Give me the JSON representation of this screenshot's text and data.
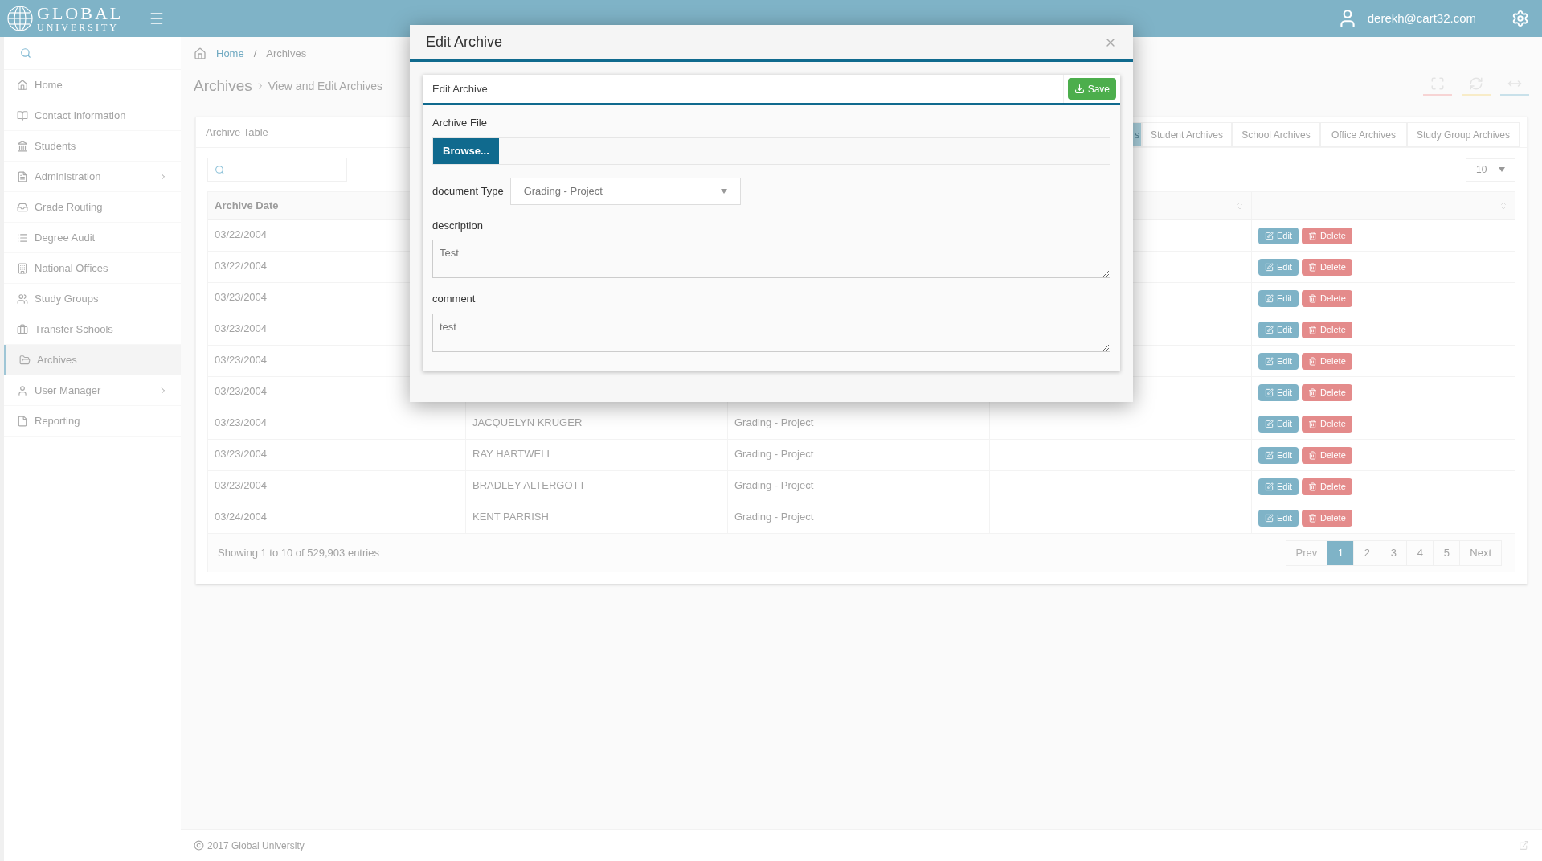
{
  "header": {
    "logo_top": "GLOBAL",
    "logo_bottom": "UNIVERSITY",
    "user": "derekh@cart32.com"
  },
  "sidebar": {
    "items": [
      {
        "label": "Home",
        "selected": false,
        "submenu": false
      },
      {
        "label": "Contact Information",
        "selected": false,
        "submenu": false
      },
      {
        "label": "Students",
        "selected": false,
        "submenu": false
      },
      {
        "label": "Administration",
        "selected": false,
        "submenu": true
      },
      {
        "label": "Grade Routing",
        "selected": false,
        "submenu": false
      },
      {
        "label": "Degree Audit",
        "selected": false,
        "submenu": false
      },
      {
        "label": "National Offices",
        "selected": false,
        "submenu": false
      },
      {
        "label": "Study Groups",
        "selected": false,
        "submenu": false
      },
      {
        "label": "Transfer Schools",
        "selected": false,
        "submenu": false
      },
      {
        "label": "Archives",
        "selected": true,
        "submenu": false
      },
      {
        "label": "User Manager",
        "selected": false,
        "submenu": true
      },
      {
        "label": "Reporting",
        "selected": false,
        "submenu": false
      }
    ]
  },
  "breadcrumb": {
    "items": [
      "Home",
      "Archives"
    ],
    "separator": "/"
  },
  "page_title": {
    "title": "Archives",
    "subtitle": "View and Edit Archives"
  },
  "panel": {
    "title": "Archive Table",
    "tabs": [
      {
        "label": "s",
        "selected": true
      },
      {
        "label": "Student Archives",
        "selected": false
      },
      {
        "label": "School Archives",
        "selected": false
      },
      {
        "label": "Office Archives",
        "selected": false
      },
      {
        "label": "Study Group Archives",
        "selected": false
      }
    ],
    "page_size": "10",
    "columns": [
      "Archive Date"
    ],
    "rows": [
      {
        "date": "03/22/2004",
        "actions": [
          "Edit",
          "Delete"
        ]
      },
      {
        "date": "03/22/2004",
        "actions": [
          "Edit",
          "Delete"
        ]
      },
      {
        "date": "03/23/2004",
        "actions": [
          "Edit",
          "Delete"
        ]
      },
      {
        "date": "03/23/2004",
        "actions": [
          "Edit",
          "Delete"
        ]
      },
      {
        "date": "03/23/2004",
        "actions": [
          "Edit",
          "Delete"
        ]
      },
      {
        "date": "03/23/2004",
        "actions": [
          "Edit",
          "Delete"
        ]
      },
      {
        "date": "03/23/2004",
        "name": "JACQUELYN KRUGER",
        "type": "Grading - Project",
        "actions": [
          "Edit",
          "Delete"
        ]
      },
      {
        "date": "03/23/2004",
        "name": "RAY HARTWELL",
        "type": "Grading - Project",
        "actions": [
          "Edit",
          "Delete"
        ]
      },
      {
        "date": "03/23/2004",
        "name": "BRADLEY ALTERGOTT",
        "type": "Grading - Project",
        "actions": [
          "Edit",
          "Delete"
        ]
      },
      {
        "date": "03/24/2004",
        "name": "KENT PARRISH",
        "type": "Grading - Project",
        "actions": [
          "Edit",
          "Delete"
        ]
      }
    ],
    "summary": "Showing 1 to 10 of 529,903 entries",
    "pagination": {
      "prev": "Prev",
      "next": "Next",
      "pages": [
        {
          "label": "1",
          "selected": true
        },
        {
          "label": "2",
          "selected": false
        },
        {
          "label": "3",
          "selected": false
        },
        {
          "label": "4",
          "selected": false
        },
        {
          "label": "5",
          "selected": false
        }
      ]
    }
  },
  "footer": "2017 Global University",
  "modal": {
    "title": "Edit Archive",
    "card_title": "Edit Archive",
    "save": "Save",
    "file_label": "Archive File",
    "browse": "Browse...",
    "type_label": "document Type",
    "type_value": "Grading - Project",
    "description_label": "description",
    "description": "Test",
    "comment_label": "comment",
    "comment": "test"
  }
}
